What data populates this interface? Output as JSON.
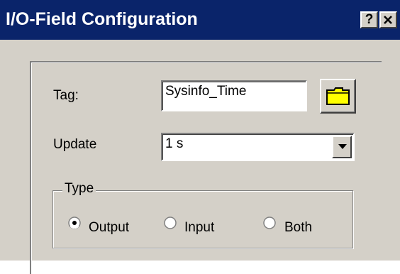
{
  "window": {
    "title": "I/O-Field Configuration",
    "help_button": "?",
    "close_button": "✕"
  },
  "form": {
    "tag_label": "Tag:",
    "tag_value": "Sysinfo_Time",
    "update_label": "Update",
    "update_value": "1 s",
    "browse_icon": "folder-icon"
  },
  "type_group": {
    "legend": "Type",
    "options": [
      {
        "label": "Output",
        "selected": true
      },
      {
        "label": "Input",
        "selected": false
      },
      {
        "label": "Both",
        "selected": false
      }
    ]
  },
  "colors": {
    "titlebar": "#0a246a",
    "face": "#d4d0c8",
    "folder": "#ffff00"
  }
}
